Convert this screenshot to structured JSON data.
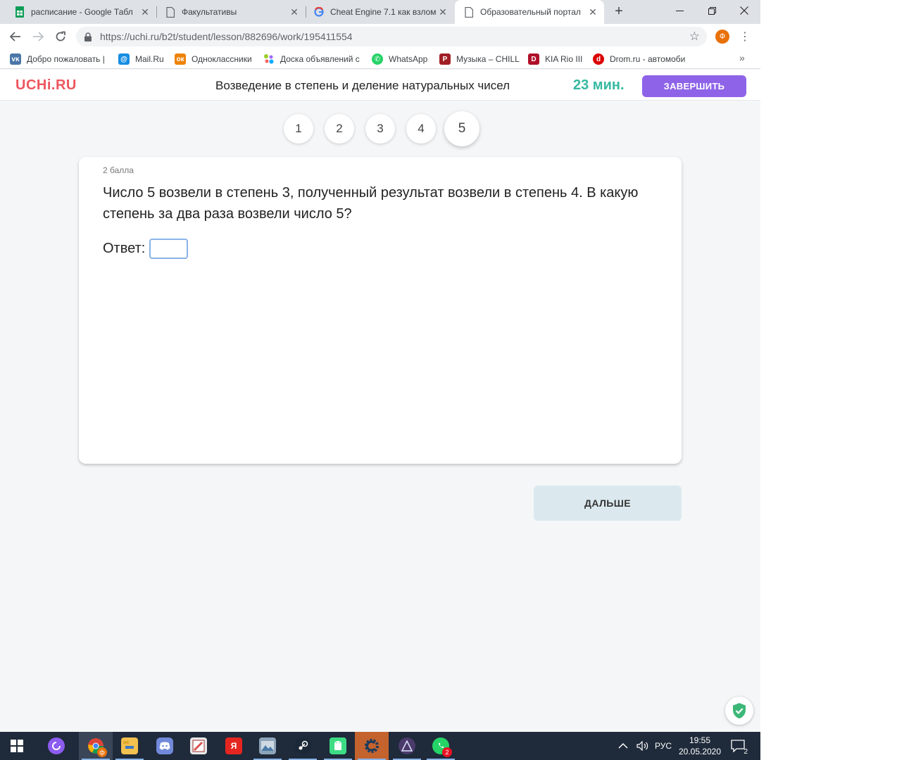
{
  "browser": {
    "tabs": [
      {
        "label": "расписание - Google Табл",
        "icon": "sheets-icon",
        "active": false
      },
      {
        "label": "Факультативы",
        "icon": "document-icon",
        "active": false
      },
      {
        "label": "Cheat Engine 7.1 как взлом",
        "icon": "google-icon",
        "active": false
      },
      {
        "label": "Образовательный портал",
        "icon": "document-icon",
        "active": true
      }
    ],
    "url_host": "https://uchi.ru",
    "url_path": "/b2t/student/lesson/882696/work/195411554",
    "profile_letter": "Ф",
    "bookmarks": [
      {
        "label": "Добро пожаловать |",
        "icon": "vk-icon",
        "color": "#4a76a8",
        "glyph": "VK"
      },
      {
        "label": "Mail.Ru",
        "icon": "mailru-icon",
        "color": "#168de2",
        "glyph": "@"
      },
      {
        "label": "Одноклассники",
        "icon": "ok-icon",
        "color": "#ee8208",
        "glyph": "ok"
      },
      {
        "label": "Доска объявлений с",
        "icon": "avito-icon",
        "color": "#97cf26",
        "glyph": "•"
      },
      {
        "label": "WhatsApp",
        "icon": "whatsapp-icon",
        "color": "#25d366",
        "glyph": "✆"
      },
      {
        "label": "Музыка – CHILL",
        "icon": "music-icon",
        "color": "#a01f24",
        "glyph": "P"
      },
      {
        "label": "KIA Rio III",
        "icon": "drive2-icon",
        "color": "#b0102a",
        "glyph": "D"
      },
      {
        "label": "Drom.ru - автомоби",
        "icon": "drom-icon",
        "color": "#db0000",
        "glyph": "d"
      }
    ]
  },
  "site": {
    "logo": "UCHi.RU",
    "lesson_title": "Возведение в степень и деление натуральных чисел",
    "timer": "23 мин.",
    "finish_label": "ЗАВЕРШИТЬ",
    "steps": [
      "1",
      "2",
      "3",
      "4",
      "5"
    ],
    "current_step": "5",
    "task": {
      "points": "2 балла",
      "question": "Число 5 возвели в степень 3, полученный результат возвели в степень 4. В какую степень за два раза возвели число 5?",
      "answer_label": "Ответ:",
      "answer_value": ""
    },
    "next_label": "ДАЛЬШЕ"
  },
  "taskbar": {
    "apps": [
      {
        "name": "start-button",
        "color": "#1f2a3a",
        "glyph": "⊞"
      },
      {
        "name": "alice-icon",
        "color": "#8c5cf0",
        "glyph": "●"
      },
      {
        "name": "chrome-icon",
        "color": "#db4437",
        "glyph": "◉"
      },
      {
        "name": "file-explorer-icon",
        "color": "#f2c14e",
        "glyph": "▭"
      },
      {
        "name": "discord-icon",
        "color": "#7289da",
        "glyph": "◐"
      },
      {
        "name": "paint-icon",
        "color": "#d9534f",
        "glyph": "✎"
      },
      {
        "name": "yandex-browser-icon",
        "color": "#e52620",
        "glyph": "Я"
      },
      {
        "name": "photos-icon",
        "color": "#6c7a89",
        "glyph": "▣"
      },
      {
        "name": "steam-icon",
        "color": "#1b2838",
        "glyph": "◎"
      },
      {
        "name": "android-emulator-icon",
        "color": "#3ddc84",
        "glyph": "▤"
      },
      {
        "name": "cheat-engine-icon",
        "color": "#2d3b4e",
        "glyph": "⚙"
      },
      {
        "name": "game-icon",
        "color": "#4a3b6b",
        "glyph": "▲"
      },
      {
        "name": "whatsapp-taskbar-icon",
        "color": "#25d366",
        "glyph": "✆"
      }
    ],
    "whatsapp_badge": "2",
    "language": "РУС",
    "time": "19:55",
    "date": "20.05.2020",
    "notifications_count": "2"
  }
}
